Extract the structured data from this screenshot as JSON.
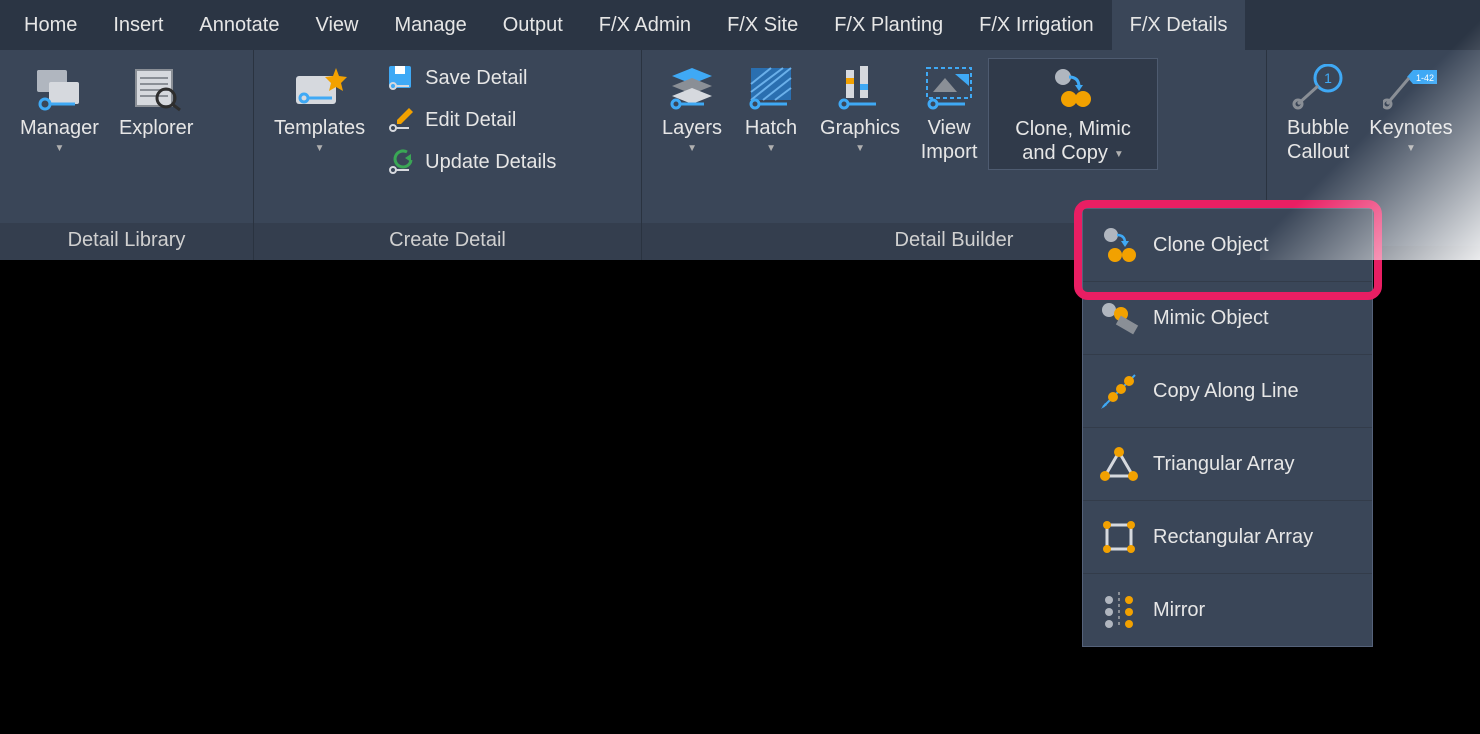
{
  "tabs": [
    {
      "label": "Home"
    },
    {
      "label": "Insert"
    },
    {
      "label": "Annotate"
    },
    {
      "label": "View"
    },
    {
      "label": "Manage"
    },
    {
      "label": "Output"
    },
    {
      "label": "F/X Admin"
    },
    {
      "label": "F/X Site"
    },
    {
      "label": "F/X Planting"
    },
    {
      "label": "F/X Irrigation"
    },
    {
      "label": "F/X Details"
    }
  ],
  "panels": {
    "library": {
      "title": "Detail Library",
      "manager": "Manager",
      "explorer": "Explorer"
    },
    "create": {
      "title": "Create Detail",
      "templates": "Templates",
      "save": "Save Detail",
      "edit": "Edit Detail",
      "update": "Update Details"
    },
    "builder": {
      "title": "Detail Builder",
      "layers": "Layers",
      "hatch": "Hatch",
      "graphics": "Graphics",
      "view_import_l1": "View",
      "view_import_l2": "Import",
      "clone_l1": "Clone, Mimic",
      "clone_l2": "and Copy"
    },
    "callout": {
      "bubble_l1": "Bubble",
      "bubble_l2": "Callout",
      "keynotes": "Keynotes"
    }
  },
  "dropdown": {
    "clone": "Clone Object",
    "mimic": "Mimic Object",
    "copy": "Copy Along Line",
    "tri": "Triangular Array",
    "rect": "Rectangular Array",
    "mirror": "Mirror"
  }
}
